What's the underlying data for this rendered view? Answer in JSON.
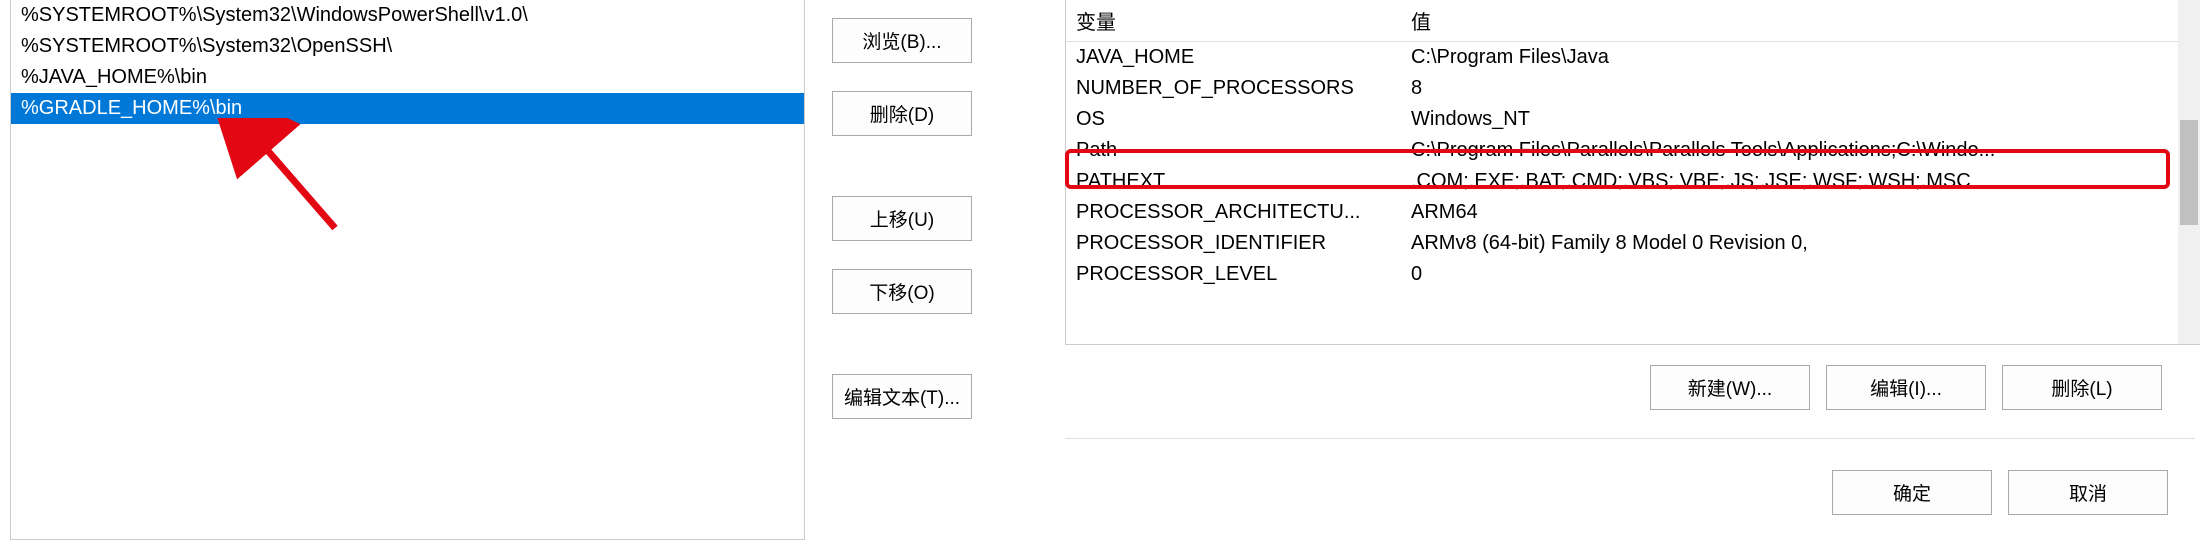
{
  "left_panel": {
    "path_entries": [
      "%SYSTEMROOT%\\System32\\WindowsPowerShell\\v1.0\\",
      "%SYSTEMROOT%\\System32\\OpenSSH\\",
      "%JAVA_HOME%\\bin",
      "%GRADLE_HOME%\\bin"
    ],
    "selected_index": 3,
    "edit_value": ""
  },
  "mid_buttons": {
    "browse": "浏览(B)...",
    "delete": "删除(D)",
    "move_up": "上移(U)",
    "move_down": "下移(O)",
    "edit_text": "编辑文本(T)..."
  },
  "env_table": {
    "headers": {
      "variable": "变量",
      "value": "值"
    },
    "rows": [
      {
        "variable": "JAVA_HOME",
        "value": "C:\\Program Files\\Java"
      },
      {
        "variable": "NUMBER_OF_PROCESSORS",
        "value": "8"
      },
      {
        "variable": "OS",
        "value": "Windows_NT"
      },
      {
        "variable": "Path",
        "value": "C:\\Program Files\\Parallels\\Parallels Tools\\Applications;C:\\Windo..."
      },
      {
        "variable": "PATHEXT",
        "value": ".COM;.EXE;.BAT;.CMD;.VBS;.VBE;.JS;.JSE;.WSF;.WSH;.MSC"
      },
      {
        "variable": "PROCESSOR_ARCHITECTU...",
        "value": "ARM64"
      },
      {
        "variable": "PROCESSOR_IDENTIFIER",
        "value": "ARMv8 (64-bit) Family 8 Model 0 Revision   0,"
      },
      {
        "variable": "PROCESSOR_LEVEL",
        "value": "0"
      }
    ],
    "highlighted_index": 3
  },
  "right_buttons": {
    "new": "新建(W)...",
    "edit": "编辑(I)...",
    "delete": "删除(L)"
  },
  "bottom_buttons": {
    "ok": "确定",
    "cancel": "取消"
  },
  "annotation": {
    "color": "#e30613"
  }
}
